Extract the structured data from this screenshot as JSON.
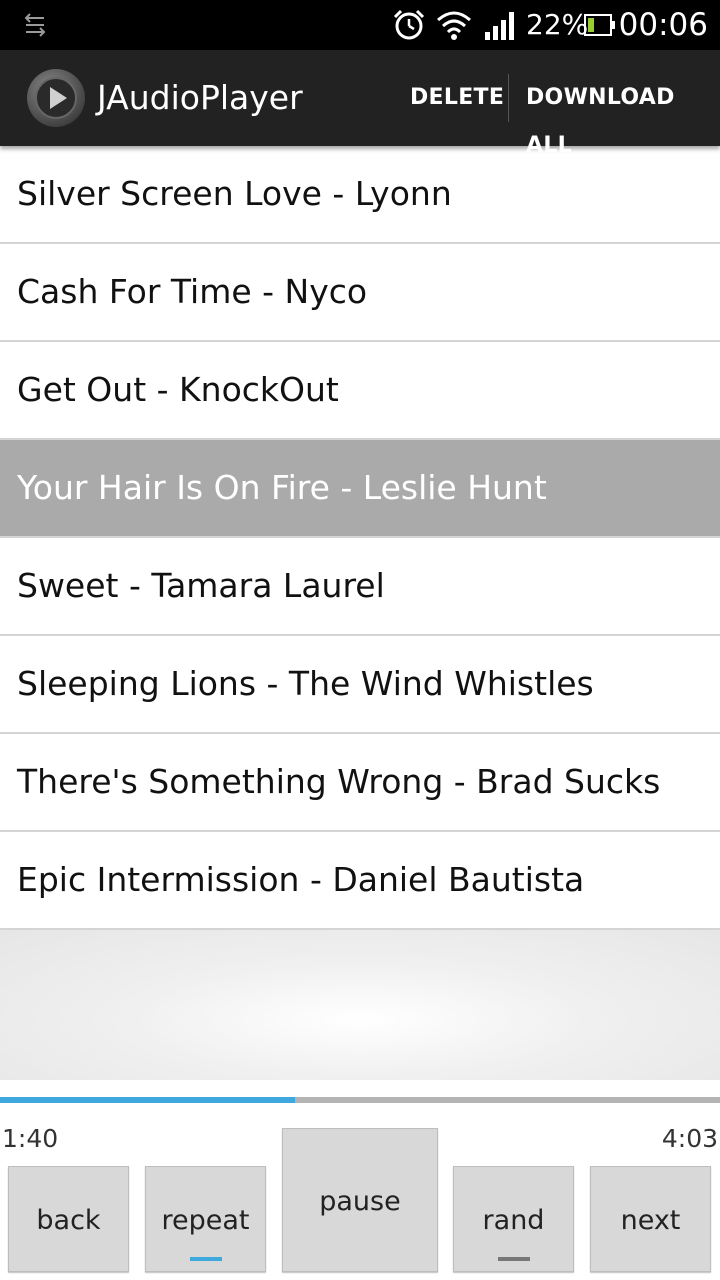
{
  "status_bar": {
    "battery_percent": "22%",
    "time": "00:06",
    "icons": [
      "usb-debug-icon",
      "alarm-icon",
      "wifi-icon",
      "signal-icon",
      "battery-icon"
    ]
  },
  "action_bar": {
    "title": "JAudioPlayer",
    "delete_label": "DELETE",
    "download_all_label": "DOWNLOAD ALL"
  },
  "tracks": [
    {
      "label": "Silver Screen Love - Lyonn",
      "selected": false
    },
    {
      "label": "Cash For Time - Nyco",
      "selected": false
    },
    {
      "label": "Get Out - KnockOut",
      "selected": false
    },
    {
      "label": "Your Hair Is On Fire - Leslie Hunt",
      "selected": true
    },
    {
      "label": "Sweet - Tamara Laurel",
      "selected": false
    },
    {
      "label": "Sleeping Lions - The Wind Whistles",
      "selected": false
    },
    {
      "label": "There's Something Wrong - Brad Sucks",
      "selected": false
    },
    {
      "label": "Epic Intermission - Daniel Bautista",
      "selected": false
    }
  ],
  "player": {
    "elapsed": "1:40",
    "total": "4:03",
    "progress_fraction": 0.41,
    "buttons": {
      "back": "back",
      "repeat": "repeat",
      "pause": "pause",
      "rand": "rand",
      "next": "next"
    },
    "repeat_active": true,
    "rand_active": false
  },
  "colors": {
    "accent": "#3fa9de",
    "selected_row": "#aaaaaa",
    "action_bar": "#222222",
    "indicator_off": "#777777"
  }
}
